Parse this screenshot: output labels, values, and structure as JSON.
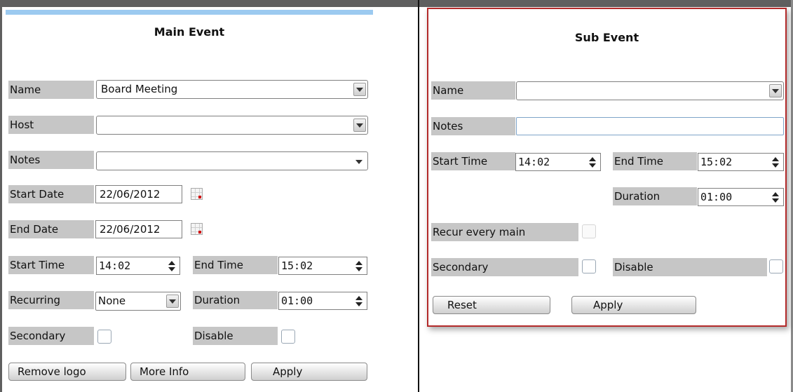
{
  "main": {
    "title": "Main Event",
    "name_label": "Name",
    "name_value": "Board Meeting",
    "host_label": "Host",
    "host_value": "",
    "notes_label": "Notes",
    "notes_value": "",
    "start_date_label": "Start Date",
    "start_date_value": "22/06/2012",
    "end_date_label": "End Date",
    "end_date_value": "22/06/2012",
    "start_time_label": "Start Time",
    "start_time_value": "14:02",
    "end_time_label": "End Time",
    "end_time_value": "15:02",
    "recurring_label": "Recurring",
    "recurring_value": "None",
    "duration_label": "Duration",
    "duration_value": "01:00",
    "secondary_label": "Secondary",
    "disable_label": "Disable",
    "remove_logo_label": "Remove logo",
    "more_info_label": "More Info",
    "apply_label": "Apply"
  },
  "sub": {
    "title": "Sub Event",
    "name_label": "Name",
    "name_value": "",
    "notes_label": "Notes",
    "notes_value": "",
    "start_time_label": "Start Time",
    "start_time_value": "14:02",
    "end_time_label": "End Time",
    "end_time_value": "15:02",
    "duration_label": "Duration",
    "duration_value": "01:00",
    "recur_label": "Recur every main",
    "secondary_label": "Secondary",
    "disable_label": "Disable",
    "reset_label": "Reset",
    "apply_label": "Apply"
  },
  "colors": {
    "label_bg": "#c6c6c6",
    "highlight_border": "#b32a2a",
    "top_accent": "#9ccaf0"
  }
}
